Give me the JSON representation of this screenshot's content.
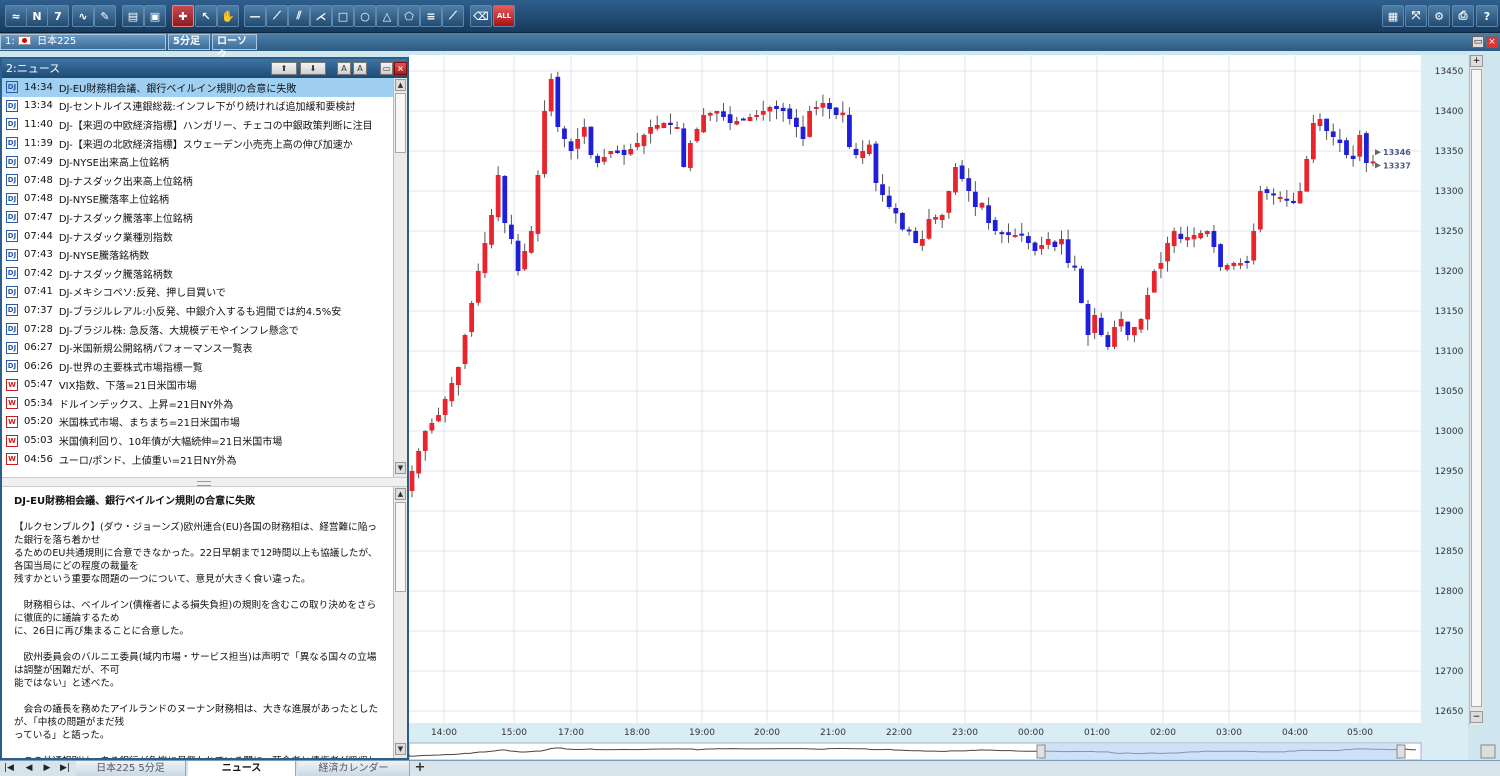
{
  "toolbar": {
    "buttons": [
      {
        "name": "chart-icon",
        "glyph": "≈"
      },
      {
        "name": "news-icon",
        "glyph": "N"
      },
      {
        "name": "calendar-icon",
        "glyph": "7"
      },
      {
        "name": "indicator-icon",
        "glyph": "∿"
      },
      {
        "name": "pen-icon",
        "glyph": "✎"
      },
      {
        "name": "layout-icon",
        "glyph": "▤"
      },
      {
        "name": "save-icon",
        "glyph": "▣"
      },
      {
        "name": "crosshair-icon",
        "glyph": "✚"
      },
      {
        "name": "pointer-icon",
        "glyph": "↖"
      },
      {
        "name": "hand-icon",
        "glyph": "✋"
      },
      {
        "name": "horizontal-line-icon",
        "glyph": "—"
      },
      {
        "name": "trend-line-icon",
        "glyph": "⟋"
      },
      {
        "name": "channel-icon",
        "glyph": "⫽"
      },
      {
        "name": "fan-icon",
        "glyph": "⋌"
      },
      {
        "name": "rectangle-icon",
        "glyph": "□"
      },
      {
        "name": "circle-icon",
        "glyph": "○"
      },
      {
        "name": "triangle-icon",
        "glyph": "△"
      },
      {
        "name": "pentagon-icon",
        "glyph": "⬠"
      },
      {
        "name": "fibonacci-icon",
        "glyph": "≡"
      },
      {
        "name": "gann-icon",
        "glyph": "⟋"
      },
      {
        "name": "eraser-icon",
        "glyph": "⌫"
      },
      {
        "name": "delete-all-icon",
        "glyph": "ALL"
      }
    ],
    "right_buttons": [
      {
        "name": "window-layout-icon",
        "glyph": "▦"
      },
      {
        "name": "fullscreen-icon",
        "glyph": "⤧"
      },
      {
        "name": "settings-gear-icon",
        "glyph": "⚙"
      },
      {
        "name": "print-icon",
        "glyph": "⎙"
      },
      {
        "name": "help-icon",
        "glyph": "?"
      }
    ]
  },
  "chart_tabs": {
    "index": "1:",
    "instrument": "日本225",
    "interval": "5分足",
    "candle_type": "ローソク"
  },
  "news": {
    "title": "2:ニュース",
    "items": [
      {
        "src": "DJ",
        "time": "14:34",
        "headline": "DJ-EU財務相会議、銀行ベイルイン規則の合意に失敗"
      },
      {
        "src": "DJ",
        "time": "13:34",
        "headline": "DJ-セントルイス連銀総裁:インフレ下がり続ければ追加緩和要検討"
      },
      {
        "src": "DJ",
        "time": "11:40",
        "headline": "DJ-【来週の中欧経済指標】ハンガリー、チェコの中銀政策判断に注目"
      },
      {
        "src": "DJ",
        "time": "11:39",
        "headline": "DJ-【来週の北欧経済指標】スウェーデン小売売上高の伸び加速か"
      },
      {
        "src": "DJ",
        "time": "07:49",
        "headline": "DJ-NYSE出来高上位銘柄"
      },
      {
        "src": "DJ",
        "time": "07:48",
        "headline": "DJ-ナスダック出来高上位銘柄"
      },
      {
        "src": "DJ",
        "time": "07:48",
        "headline": "DJ-NYSE騰落率上位銘柄"
      },
      {
        "src": "DJ",
        "time": "07:47",
        "headline": "DJ-ナスダック騰落率上位銘柄"
      },
      {
        "src": "DJ",
        "time": "07:44",
        "headline": "DJ-ナスダック業種別指数"
      },
      {
        "src": "DJ",
        "time": "07:43",
        "headline": "DJ-NYSE騰落銘柄数"
      },
      {
        "src": "DJ",
        "time": "07:42",
        "headline": "DJ-ナスダック騰落銘柄数"
      },
      {
        "src": "DJ",
        "time": "07:41",
        "headline": "DJ-メキシコペソ:反発、押し目買いで"
      },
      {
        "src": "DJ",
        "time": "07:37",
        "headline": "DJ-ブラジルレアル:小反発、中銀介入するも週間では約4.5%安"
      },
      {
        "src": "DJ",
        "time": "07:28",
        "headline": "DJ-ブラジル株: 急反落、大規模デモやインフレ懸念で"
      },
      {
        "src": "DJ",
        "time": "06:27",
        "headline": "DJ-米国新規公開銘柄パフォーマンス一覧表"
      },
      {
        "src": "DJ",
        "time": "06:26",
        "headline": "DJ-世界の主要株式市場指標一覧"
      },
      {
        "src": "W",
        "time": "05:47",
        "headline": "VIX指数、下落=21日米国市場"
      },
      {
        "src": "W",
        "time": "05:34",
        "headline": "ドルインデックス、上昇=21日NY外為"
      },
      {
        "src": "W",
        "time": "05:20",
        "headline": "米国株式市場、まちまち=21日米国市場"
      },
      {
        "src": "W",
        "time": "05:03",
        "headline": "米国債利回り、10年債が大幅続伸=21日米国市場"
      },
      {
        "src": "W",
        "time": "04:56",
        "headline": "ユーロ/ポンド、上値重い=21日NY外為"
      }
    ],
    "article": {
      "title": "DJ-EU財務相会議、銀行ベイルイン規則の合意に失敗",
      "paragraphs": [
        [
          "【ルクセンブルク】(ダウ・ジョーンズ)欧州連合(EU)各国の財務相は、経営難に陥った銀行を落ち着かせ",
          "るためのEU共通規則に合意できなかった。22日早朝まで12時間以上も協議したが、各国当局にどの程度の裁量を",
          "残すかという重要な問題の一つについて、意見が大きく食い違った。"
        ],
        [
          "　財務相らは、ベイルイン(債権者による損失負担)の規則を含むこの取り決めをさらに徹底的に議論するため",
          "に、26日に再び集まることに合意した。"
        ],
        [
          "　欧州委員会のバルニエ委員(域内市場・サービス担当)は声明で「異なる国々の立場は調整が困難だが、不可",
          "能ではない」と述べた。"
        ],
        [
          "　会合の議長を務めたアイルランドのヌーナン財務相は、大きな進展があったとしたが、「中核の問題がまだ残",
          "っている」と語った。"
        ],
        [
          "　この共通規則は、ある銀行が危機に見舞われている間に、預金者と債権者が吸収しなければ"
        ]
      ]
    }
  },
  "bottom_tabs": [
    {
      "label": "日本225 5分足",
      "active": false
    },
    {
      "label": "ニュース",
      "active": true
    },
    {
      "label": "経済カレンダー",
      "active": false
    }
  ],
  "colors": {
    "up_candle": "#e8242c",
    "down_candle": "#1f1fd8",
    "grid": "#dfe6ec",
    "price_axis_bg": "#d9edf4"
  },
  "chart_data": {
    "type": "candlestick",
    "x_labels": [
      "14:00",
      "15:00",
      "17:00",
      "18:00",
      "19:00",
      "20:00",
      "21:00",
      "22:00",
      "23:00",
      "00:00",
      "01:00",
      "02:00",
      "03:00",
      "04:00",
      "05:00"
    ],
    "ylim": [
      12635,
      13470
    ],
    "y_ticks": [
      13450,
      13400,
      13350,
      13300,
      13250,
      13200,
      13150,
      13100,
      13050,
      13000,
      12950,
      12900,
      12850,
      12800,
      12750,
      12700,
      12650
    ],
    "price_markers": [
      13346,
      13337
    ],
    "close_path": [
      [
        0,
        12950
      ],
      [
        2,
        13000
      ],
      [
        4,
        13020
      ],
      [
        7,
        13080
      ],
      [
        9,
        13160
      ],
      [
        10,
        13200
      ],
      [
        12,
        13270
      ],
      [
        13,
        13320
      ],
      [
        14,
        13260
      ],
      [
        15,
        13240
      ],
      [
        16,
        13200
      ],
      [
        18,
        13250
      ],
      [
        19,
        13320
      ],
      [
        20,
        13400
      ],
      [
        21,
        13440
      ],
      [
        22,
        13380
      ],
      [
        24,
        13350
      ],
      [
        26,
        13380
      ],
      [
        27,
        13345
      ],
      [
        28,
        13335
      ],
      [
        30,
        13350
      ],
      [
        32,
        13345
      ],
      [
        34,
        13360
      ],
      [
        36,
        13380
      ],
      [
        38,
        13385
      ],
      [
        40,
        13380
      ],
      [
        41,
        13330
      ],
      [
        42,
        13360
      ],
      [
        44,
        13395
      ],
      [
        46,
        13400
      ],
      [
        48,
        13385
      ],
      [
        50,
        13390
      ],
      [
        52,
        13395
      ],
      [
        54,
        13405
      ],
      [
        56,
        13400
      ],
      [
        58,
        13380
      ],
      [
        59,
        13365
      ],
      [
        60,
        13400
      ],
      [
        62,
        13410
      ],
      [
        64,
        13395
      ],
      [
        65,
        13398
      ],
      [
        66,
        13355
      ],
      [
        67,
        13345
      ],
      [
        68,
        13350
      ],
      [
        69,
        13358
      ],
      [
        70,
        13310
      ],
      [
        72,
        13280
      ],
      [
        73,
        13272
      ],
      [
        74,
        13252
      ],
      [
        75,
        13250
      ],
      [
        76,
        13235
      ],
      [
        77,
        13240
      ],
      [
        78,
        13265
      ],
      [
        80,
        13270
      ],
      [
        82,
        13330
      ],
      [
        84,
        13300
      ],
      [
        85,
        13280
      ],
      [
        86,
        13285
      ],
      [
        87,
        13260
      ],
      [
        88,
        13250
      ],
      [
        90,
        13245
      ],
      [
        92,
        13245
      ],
      [
        94,
        13225
      ],
      [
        96,
        13240
      ],
      [
        97,
        13230
      ],
      [
        98,
        13240
      ],
      [
        99,
        13210
      ],
      [
        100,
        13205
      ],
      [
        101,
        13160
      ],
      [
        102,
        13120
      ],
      [
        103,
        13145
      ],
      [
        104,
        13120
      ],
      [
        105,
        13105
      ],
      [
        106,
        13130
      ],
      [
        107,
        13140
      ],
      [
        108,
        13120
      ],
      [
        110,
        13140
      ],
      [
        112,
        13200
      ],
      [
        113,
        13210
      ],
      [
        114,
        13235
      ],
      [
        115,
        13250
      ],
      [
        116,
        13240
      ],
      [
        118,
        13245
      ],
      [
        120,
        13250
      ],
      [
        121,
        13230
      ],
      [
        122,
        13205
      ],
      [
        124,
        13210
      ],
      [
        126,
        13210
      ],
      [
        127,
        13250
      ],
      [
        128,
        13300
      ],
      [
        130,
        13295
      ],
      [
        132,
        13290
      ],
      [
        133,
        13285
      ],
      [
        134,
        13300
      ],
      [
        135,
        13340
      ],
      [
        136,
        13385
      ],
      [
        137,
        13390
      ],
      [
        138,
        13375
      ],
      [
        140,
        13360
      ],
      [
        141,
        13345
      ],
      [
        142,
        13340
      ],
      [
        143,
        13370
      ],
      [
        144,
        13335
      ],
      [
        145,
        13337
      ]
    ]
  }
}
